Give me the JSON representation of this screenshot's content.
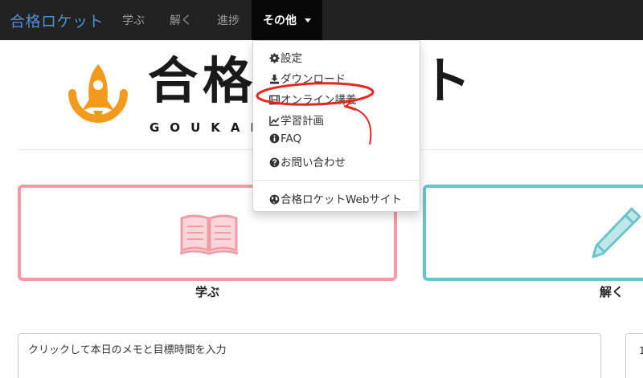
{
  "navbar": {
    "brand": "合格ロケット",
    "items": [
      {
        "label": "学ぶ"
      },
      {
        "label": "解く"
      },
      {
        "label": "進捗"
      }
    ],
    "active": {
      "label": "その他"
    },
    "bg_color": "#222222"
  },
  "logo": {
    "title": "合格ロケット",
    "subtitle": "GOUKAKUROCKET",
    "accent_color": "#f39a1e"
  },
  "dropdown": {
    "items": [
      {
        "label": "設定",
        "icon": "gear-icon"
      },
      {
        "label": "ダウンロード",
        "icon": "download-icon"
      },
      {
        "label": "オンライン講義",
        "icon": "film-icon"
      },
      {
        "label": "学習計画",
        "icon": "chart-line-icon"
      },
      {
        "label": "FAQ",
        "icon": "info-circle-icon"
      },
      {
        "label": "お問い合わせ",
        "icon": "question-circle-icon"
      }
    ],
    "footer_item": {
      "label": "合格ロケットWebサイト",
      "icon": "globe-icon"
    }
  },
  "cards": {
    "learn": {
      "label": "学ぶ",
      "color": "#ef9ca5"
    },
    "solve": {
      "label": "解く",
      "color": "#6ac5cb"
    }
  },
  "memo": {
    "placeholder": "クリックして本日のメモと目標時間を入力"
  },
  "right_box": {
    "text": "1"
  },
  "annotation_color": "#e8261c"
}
